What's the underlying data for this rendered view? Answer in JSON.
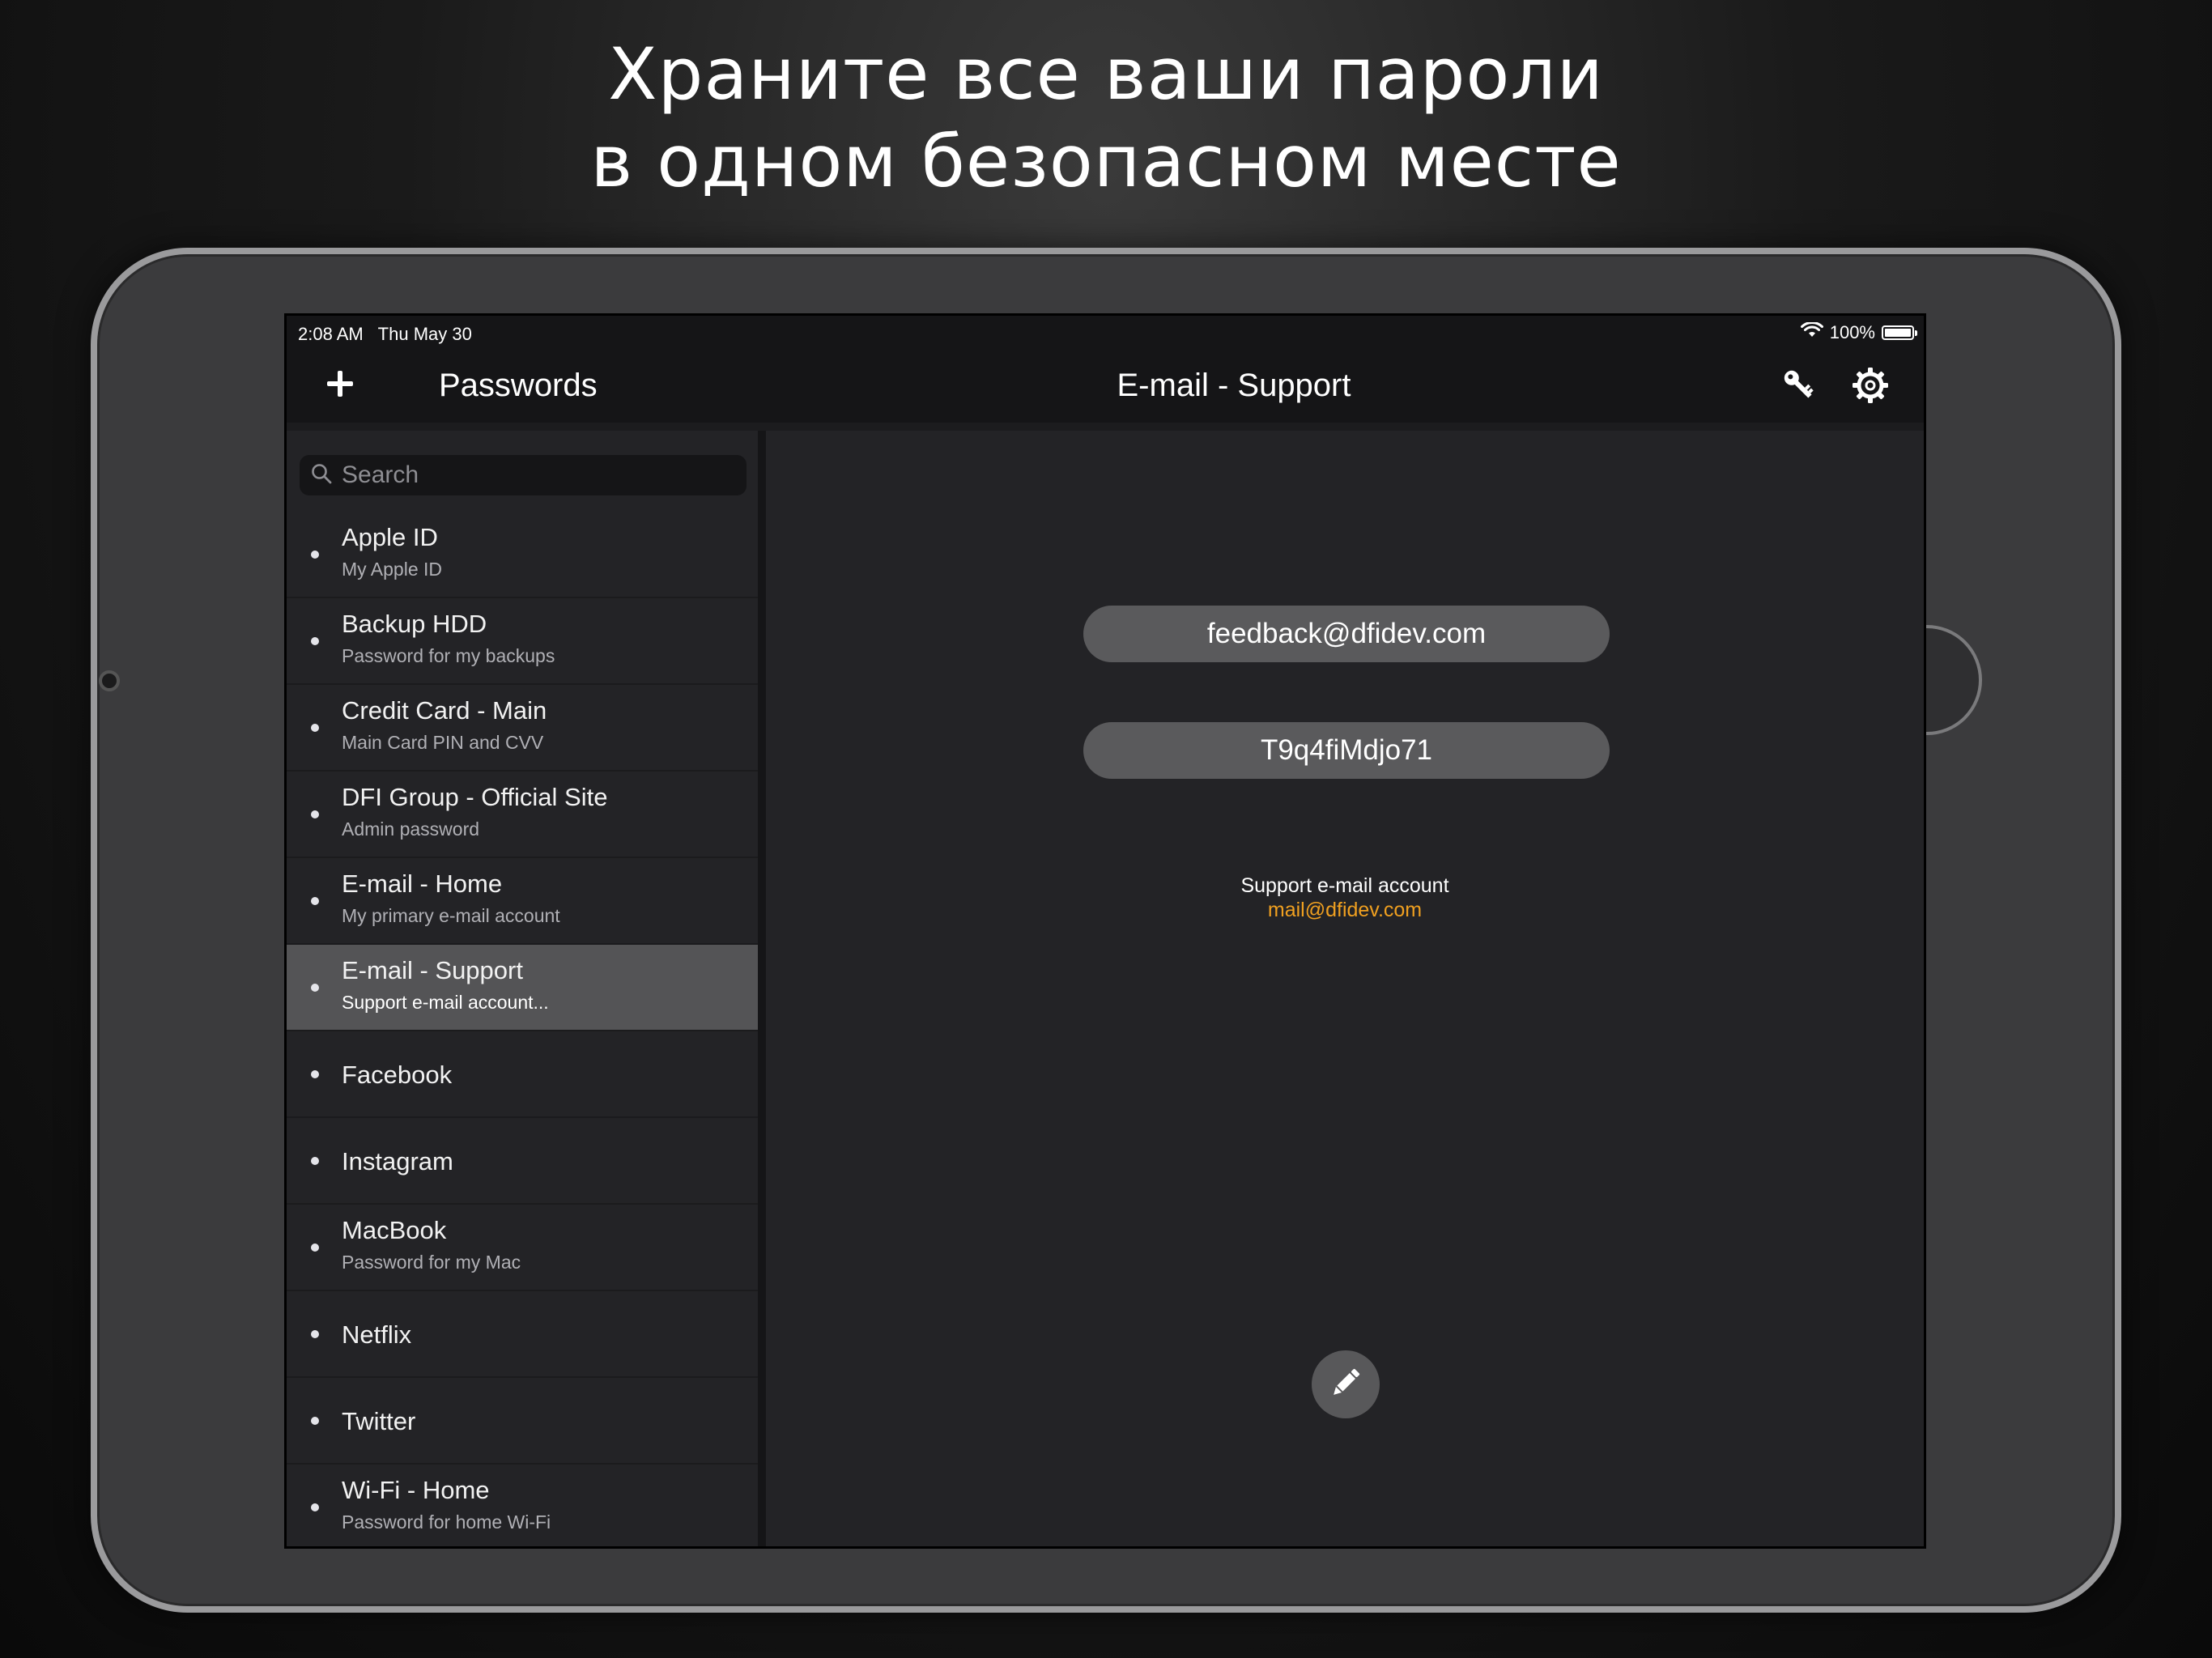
{
  "headline": {
    "line1": "Храните все ваши пароли",
    "line2": "в одном безопасном месте"
  },
  "status_bar": {
    "time": "2:08 AM",
    "date": "Thu May 30",
    "battery": "100%",
    "battery_level": 1.0,
    "wifi_icon": "wifi-icon",
    "battery_icon": "battery-icon"
  },
  "nav": {
    "add_icon": "plus-icon",
    "sidebar_title": "Passwords",
    "detail_title": "E-mail - Support",
    "key_icon": "key-icon",
    "settings_icon": "gear-icon"
  },
  "search": {
    "placeholder": "Search",
    "value": ""
  },
  "items": [
    {
      "title": "Apple ID",
      "subtitle": "My Apple ID"
    },
    {
      "title": "Backup HDD",
      "subtitle": "Password for my backups"
    },
    {
      "title": "Credit Card - Main",
      "subtitle": "Main Card PIN and CVV"
    },
    {
      "title": "DFI Group - Official Site",
      "subtitle": "Admin password"
    },
    {
      "title": "E-mail - Home",
      "subtitle": "My primary e-mail account"
    },
    {
      "title": "E-mail - Support",
      "subtitle": "Support e-mail account...",
      "selected": true
    },
    {
      "title": "Facebook",
      "subtitle": ""
    },
    {
      "title": "Instagram",
      "subtitle": ""
    },
    {
      "title": "MacBook",
      "subtitle": "Password for my Mac"
    },
    {
      "title": "Netflix",
      "subtitle": ""
    },
    {
      "title": "Twitter",
      "subtitle": ""
    },
    {
      "title": "Wi-Fi - Home",
      "subtitle": "Password for home Wi-Fi"
    }
  ],
  "detail": {
    "login": "feedback@dfidev.com",
    "password": "T9q4fiMdjo71",
    "note": "Support e-mail account",
    "link": "mail@dfidev.com",
    "edit_icon": "pencil-icon"
  },
  "colors": {
    "accent_link": "#f0a020",
    "selected_row": "#545456",
    "pill": "#5a5a5c",
    "panel": "#232326"
  }
}
